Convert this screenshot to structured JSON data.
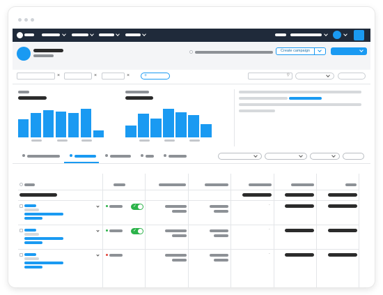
{
  "header": {
    "create_button_label": "Create campaign"
  },
  "filters": {
    "add_label": "+"
  },
  "table": {
    "dash": "-"
  },
  "colors": {
    "nav_bg": "#1f2a3a",
    "accent": "#1a9af2",
    "toggle_on": "#2cb34a",
    "status_green": "#2cb34a",
    "status_red": "#e2463c"
  },
  "icons": [
    "avatar",
    "chevron-down-icon",
    "close-icon",
    "search-icon",
    "check-icon"
  ]
}
